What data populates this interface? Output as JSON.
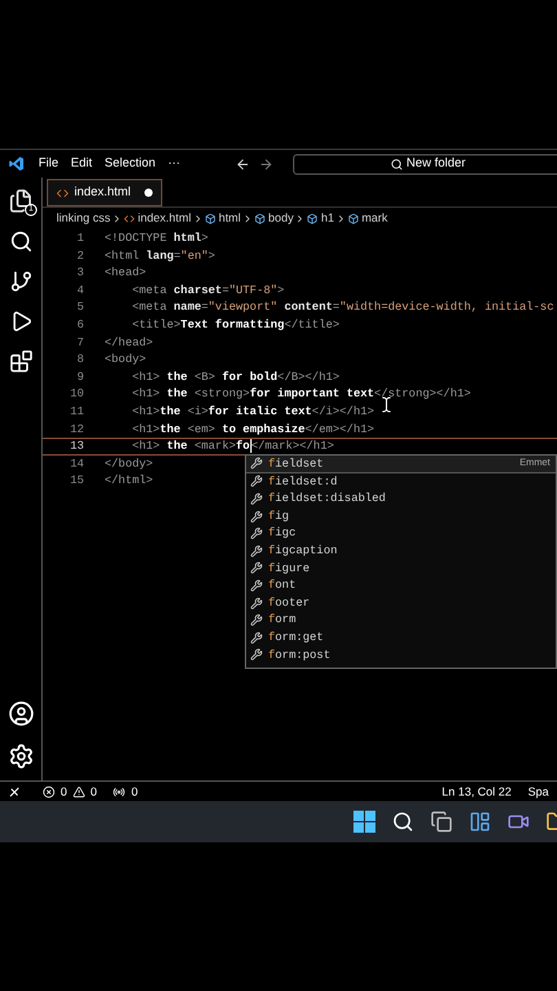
{
  "title_bar": {
    "menus": [
      "File",
      "Edit",
      "Selection",
      "···"
    ],
    "command_center": "New folder"
  },
  "activity_bar": {
    "explorer_badge": "1"
  },
  "tabs": [
    {
      "label": "index.html",
      "selected": true,
      "modified": true
    }
  ],
  "breadcrumbs": [
    {
      "label": "linking css",
      "kind": "folder"
    },
    {
      "label": "index.html",
      "kind": "file"
    },
    {
      "label": "html",
      "kind": "symbol"
    },
    {
      "label": "body",
      "kind": "symbol"
    },
    {
      "label": "h1",
      "kind": "symbol"
    },
    {
      "label": "mark",
      "kind": "symbol"
    }
  ],
  "editor": {
    "lines": [
      {
        "number": "1",
        "current": false,
        "tokens": [
          {
            "kind": "tag",
            "text": "<!DOCTYPE "
          },
          {
            "kind": "attr",
            "text": "html"
          },
          {
            "kind": "tag",
            "text": ">"
          }
        ]
      },
      {
        "number": "2",
        "current": false,
        "tokens": [
          {
            "kind": "tag",
            "text": "<html "
          },
          {
            "kind": "attr",
            "text": "lang"
          },
          {
            "kind": "tag",
            "text": "="
          },
          {
            "kind": "str",
            "text": "\"en\""
          },
          {
            "kind": "tag",
            "text": ">"
          }
        ]
      },
      {
        "number": "3",
        "current": false,
        "tokens": [
          {
            "kind": "tag",
            "text": "<head>"
          }
        ]
      },
      {
        "number": "4",
        "current": false,
        "tokens": [
          {
            "kind": "tag",
            "text": "    <meta "
          },
          {
            "kind": "attr",
            "text": "charset"
          },
          {
            "kind": "tag",
            "text": "="
          },
          {
            "kind": "str",
            "text": "\"UTF-8\""
          },
          {
            "kind": "tag",
            "text": ">"
          }
        ]
      },
      {
        "number": "5",
        "current": false,
        "tokens": [
          {
            "kind": "tag",
            "text": "    <meta "
          },
          {
            "kind": "attr",
            "text": "name"
          },
          {
            "kind": "tag",
            "text": "="
          },
          {
            "kind": "str",
            "text": "\"viewport\" "
          },
          {
            "kind": "attr",
            "text": "content"
          },
          {
            "kind": "tag",
            "text": "="
          },
          {
            "kind": "str",
            "text": "\"width=device-width, initial-sc"
          }
        ]
      },
      {
        "number": "6",
        "current": false,
        "tokens": [
          {
            "kind": "tag",
            "text": "    <title>"
          },
          {
            "kind": "text",
            "text": "Text formatting"
          },
          {
            "kind": "tag",
            "text": "</title>"
          }
        ]
      },
      {
        "number": "7",
        "current": false,
        "tokens": [
          {
            "kind": "tag",
            "text": "</head>"
          }
        ]
      },
      {
        "number": "8",
        "current": false,
        "tokens": [
          {
            "kind": "tag",
            "text": "<body>"
          }
        ]
      },
      {
        "number": "9",
        "current": false,
        "tokens": [
          {
            "kind": "tag",
            "text": "    <h1>"
          },
          {
            "kind": "text",
            "text": " the "
          },
          {
            "kind": "tag",
            "text": "<B>"
          },
          {
            "kind": "text",
            "text": " for bold"
          },
          {
            "kind": "tag",
            "text": "</B></h1>"
          }
        ]
      },
      {
        "number": "10",
        "current": false,
        "tokens": [
          {
            "kind": "tag",
            "text": "    <h1>"
          },
          {
            "kind": "text",
            "text": " the "
          },
          {
            "kind": "tag",
            "text": "<strong>"
          },
          {
            "kind": "text",
            "text": "for important text"
          },
          {
            "kind": "tag",
            "text": "</strong></h1>"
          }
        ]
      },
      {
        "number": "11",
        "current": false,
        "tokens": [
          {
            "kind": "tag",
            "text": "    <h1>"
          },
          {
            "kind": "text",
            "text": "the "
          },
          {
            "kind": "tag",
            "text": "<i>"
          },
          {
            "kind": "text",
            "text": "for italic text"
          },
          {
            "kind": "tag",
            "text": "</i></h1>"
          }
        ]
      },
      {
        "number": "12",
        "current": false,
        "tokens": [
          {
            "kind": "tag",
            "text": "    <h1>"
          },
          {
            "kind": "text",
            "text": "the "
          },
          {
            "kind": "tag",
            "text": "<em>"
          },
          {
            "kind": "text",
            "text": " to emphasize"
          },
          {
            "kind": "tag",
            "text": "</em></h1>"
          }
        ]
      },
      {
        "number": "13",
        "current": true,
        "tokens": [
          {
            "kind": "tag",
            "text": "    <h1>"
          },
          {
            "kind": "text",
            "text": " the "
          },
          {
            "kind": "tag",
            "text": "<mark>"
          },
          {
            "kind": "text",
            "text": "fo"
          },
          {
            "kind": "caret"
          },
          {
            "kind": "tag",
            "text": "</mark></h1>"
          }
        ]
      },
      {
        "number": "14",
        "current": false,
        "tokens": [
          {
            "kind": "tag",
            "text": "</body>"
          }
        ]
      },
      {
        "number": "15",
        "current": false,
        "tokens": [
          {
            "kind": "tag",
            "text": "</html>"
          }
        ]
      }
    ]
  },
  "suggestions": {
    "detail": "Emmet",
    "items": [
      {
        "label": "**f**ieldset",
        "selected": true
      },
      {
        "label": "**f**ieldset:d",
        "selected": false
      },
      {
        "label": "**f**ieldset:disabled",
        "selected": false
      },
      {
        "label": "**f**ig",
        "selected": false
      },
      {
        "label": "**f**igc",
        "selected": false
      },
      {
        "label": "**f**igcaption",
        "selected": false
      },
      {
        "label": "**f**igure",
        "selected": false
      },
      {
        "label": "**f**ont",
        "selected": false
      },
      {
        "label": "**f**ooter",
        "selected": false
      },
      {
        "label": "**f**orm",
        "selected": false
      },
      {
        "label": "**f**orm:get",
        "selected": false
      },
      {
        "label": "**f**orm:post",
        "selected": false
      }
    ]
  },
  "status_bar": {
    "errors": "0",
    "warnings": "0",
    "ports": "0",
    "position": "Ln 13, Col 22",
    "indentation": "Spa"
  }
}
